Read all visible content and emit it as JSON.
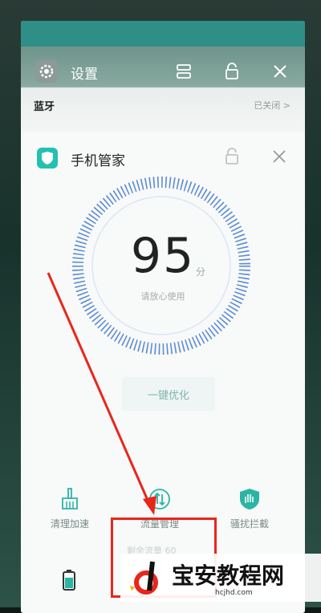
{
  "settings_card": {
    "title": "设置",
    "row_label": "蓝牙",
    "row_value": "已关闭 >"
  },
  "manager_card": {
    "title": "手机管家",
    "score": "95",
    "score_unit": "分",
    "score_sub": "请放心使用",
    "optimize_label": "一键优化",
    "features": [
      {
        "label": "清理加速",
        "icon": "broom-icon"
      },
      {
        "label": "流量管理",
        "icon": "traffic-icon"
      },
      {
        "label": "骚扰拦截",
        "icon": "shield-hand-icon"
      }
    ],
    "hidden_text": "剩余流量 60"
  },
  "watermark": {
    "text": "宝安教程网",
    "url": "hcjhd.com"
  },
  "colors": {
    "accent": "#22c1b0",
    "gauge": "#4a7fd0",
    "annotation": "#e8261c"
  }
}
